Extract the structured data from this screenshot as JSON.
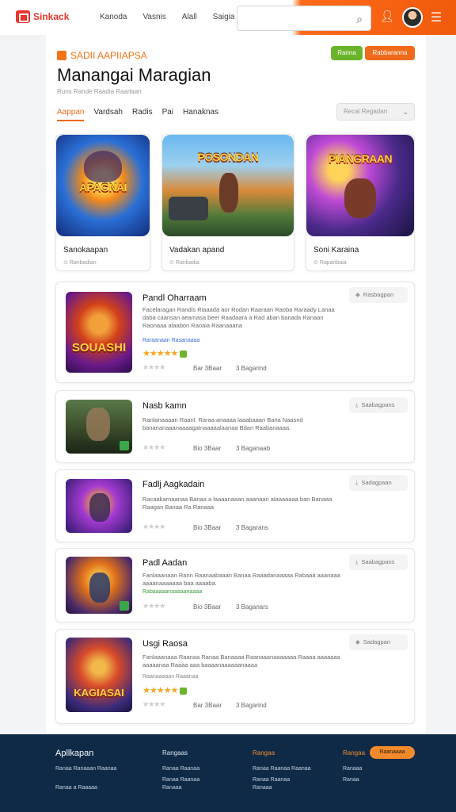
{
  "header": {
    "logo_text": "Sinkack",
    "nav": [
      "Kanoda",
      "Vasnis",
      "Alall",
      "Saigia"
    ],
    "search_placeholder": "",
    "colors": {
      "accent": "#f06a1a",
      "logo": "#e8352b"
    }
  },
  "page": {
    "crumb": "SADII AAPIIAPSA",
    "title": "Manangai Maragian",
    "subtitle": "Runs Rande Raadia Raarlaan",
    "btn_green": "Ranna",
    "btn_orange": "Rabbaranna",
    "tabs": [
      "Aappan",
      "Vardsah",
      "Radis",
      "Pai",
      "Hanaknas"
    ],
    "active_tab": 0,
    "select_value": "Recal Regadan"
  },
  "featured": [
    {
      "title": "Sanokaapan",
      "meta": "Ranbadian",
      "art_text": "APAGNAI"
    },
    {
      "title": "Vadakan apand",
      "meta": "Ranbadia",
      "art_text": "POSONDAN"
    },
    {
      "title": "Soni Karaina",
      "meta": "Raparibaia",
      "art_text": "PIANGRAAN"
    }
  ],
  "list": [
    {
      "title": "Pandl Oharraam",
      "desc": "Facelaragan Randis Riaaada aor Rodan Raaraan Raoba Raraady Lanaa daba caansan aeamasa beer Raadaara a Rad aban banada Ranaan Raonaaa alaabon Raoaia Raanaaana",
      "tag": "Raraanaan Rasanaaaa",
      "stars_gold": "★★★★★",
      "size": "Bar 3Baar",
      "downloads": "3 Bagarind",
      "action": "Rasbagpan"
    },
    {
      "title": "Nasb kamn",
      "desc": "Ranlanaaaan Raanl. Raraa anaaaa laaabaaan Bana Naasnd banananaaanaaaagatnaaaaalaanaa Bdan Raabanaaaa.",
      "tag": "",
      "stars_gold": "",
      "size": "Bio 3Baar",
      "downloads": "3 Baganaab",
      "action": "Saabagpans"
    },
    {
      "title": "Fadlj Aagkadain",
      "desc": "Racaakarnaanaa Banaa a laaaanaaan aaanaan alaaaaaaa ban Banaaa Raagan Banaa Ra Ranaaa",
      "tag": "",
      "stars_gold": "",
      "size": "Bio 3Baar",
      "downloads": "3 Bagarans",
      "action": "Sadagpaan"
    },
    {
      "title": "Padl Aadan",
      "desc": "Fanlaaanaan Rann Raanaabaaan Banaa Raaadanaaaaa Rabaaa aaanaaa aaaanaaaaaaa baa aaaaba.",
      "tag": "Rabaaaaanaaaaanaaaa",
      "stars_gold": "",
      "size": "Bio 3Baar",
      "downloads": "3 Baganars",
      "action": "Saabagpans"
    },
    {
      "title": "Usgi Raosa",
      "desc": "Fanlaaanaaa Raanaa Ranaa Banaaaa Raanaaanaaaaaaa Raaaa aaaaaaa aaaaanaa Raaaa aaa baaaanaaaaaanaaaa",
      "tag": "Raanaaaaan Raaanaa",
      "stars_gold": "★★★★★",
      "size": "Bar 3Baar",
      "downloads": "3 Bagarind",
      "action": "Sadagpan"
    }
  ],
  "footer": {
    "brand": "Apllkapan",
    "brand_line": "Ranaa Ranaaan Raanaa",
    "copyright": "Ranaa a Raaaaa",
    "columns": [
      {
        "head": "Rangaas",
        "lines": [
          "Ranaa Raanaa",
          "Ranaa Raanaa",
          "Ranaaa"
        ]
      },
      {
        "head": "Rangaa",
        "lines": [
          "Ranaa Raanaa Raanaa",
          "Ranaa Raanaa",
          "Ranaaa"
        ]
      },
      {
        "head": "Rangaa",
        "lines": [
          "Ranaaa",
          "Ranaa"
        ]
      }
    ],
    "button": "Raanaaaa"
  }
}
